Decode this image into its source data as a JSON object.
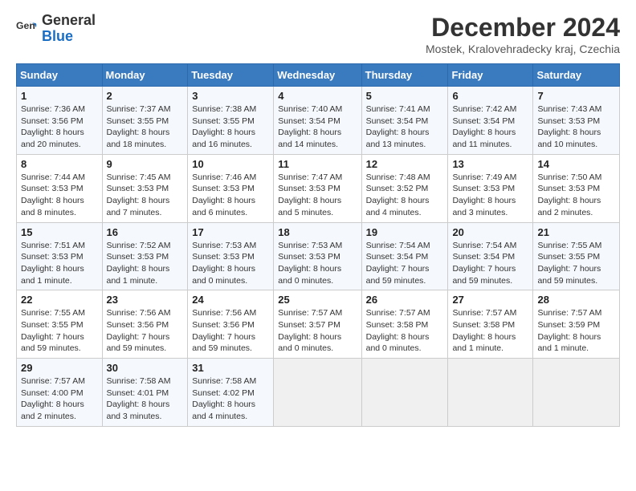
{
  "header": {
    "logo_general": "General",
    "logo_blue": "Blue",
    "title": "December 2024",
    "location": "Mostek, Kralovehradecky kraj, Czechia"
  },
  "weekdays": [
    "Sunday",
    "Monday",
    "Tuesday",
    "Wednesday",
    "Thursday",
    "Friday",
    "Saturday"
  ],
  "weeks": [
    [
      {
        "day": "1",
        "sunrise": "7:36 AM",
        "sunset": "3:56 PM",
        "daylight": "8 hours and 20 minutes."
      },
      {
        "day": "2",
        "sunrise": "7:37 AM",
        "sunset": "3:55 PM",
        "daylight": "8 hours and 18 minutes."
      },
      {
        "day": "3",
        "sunrise": "7:38 AM",
        "sunset": "3:55 PM",
        "daylight": "8 hours and 16 minutes."
      },
      {
        "day": "4",
        "sunrise": "7:40 AM",
        "sunset": "3:54 PM",
        "daylight": "8 hours and 14 minutes."
      },
      {
        "day": "5",
        "sunrise": "7:41 AM",
        "sunset": "3:54 PM",
        "daylight": "8 hours and 13 minutes."
      },
      {
        "day": "6",
        "sunrise": "7:42 AM",
        "sunset": "3:54 PM",
        "daylight": "8 hours and 11 minutes."
      },
      {
        "day": "7",
        "sunrise": "7:43 AM",
        "sunset": "3:53 PM",
        "daylight": "8 hours and 10 minutes."
      }
    ],
    [
      {
        "day": "8",
        "sunrise": "7:44 AM",
        "sunset": "3:53 PM",
        "daylight": "8 hours and 8 minutes."
      },
      {
        "day": "9",
        "sunrise": "7:45 AM",
        "sunset": "3:53 PM",
        "daylight": "8 hours and 7 minutes."
      },
      {
        "day": "10",
        "sunrise": "7:46 AM",
        "sunset": "3:53 PM",
        "daylight": "8 hours and 6 minutes."
      },
      {
        "day": "11",
        "sunrise": "7:47 AM",
        "sunset": "3:53 PM",
        "daylight": "8 hours and 5 minutes."
      },
      {
        "day": "12",
        "sunrise": "7:48 AM",
        "sunset": "3:52 PM",
        "daylight": "8 hours and 4 minutes."
      },
      {
        "day": "13",
        "sunrise": "7:49 AM",
        "sunset": "3:53 PM",
        "daylight": "8 hours and 3 minutes."
      },
      {
        "day": "14",
        "sunrise": "7:50 AM",
        "sunset": "3:53 PM",
        "daylight": "8 hours and 2 minutes."
      }
    ],
    [
      {
        "day": "15",
        "sunrise": "7:51 AM",
        "sunset": "3:53 PM",
        "daylight": "8 hours and 1 minute."
      },
      {
        "day": "16",
        "sunrise": "7:52 AM",
        "sunset": "3:53 PM",
        "daylight": "8 hours and 1 minute."
      },
      {
        "day": "17",
        "sunrise": "7:53 AM",
        "sunset": "3:53 PM",
        "daylight": "8 hours and 0 minutes."
      },
      {
        "day": "18",
        "sunrise": "7:53 AM",
        "sunset": "3:53 PM",
        "daylight": "8 hours and 0 minutes."
      },
      {
        "day": "19",
        "sunrise": "7:54 AM",
        "sunset": "3:54 PM",
        "daylight": "7 hours and 59 minutes."
      },
      {
        "day": "20",
        "sunrise": "7:54 AM",
        "sunset": "3:54 PM",
        "daylight": "7 hours and 59 minutes."
      },
      {
        "day": "21",
        "sunrise": "7:55 AM",
        "sunset": "3:55 PM",
        "daylight": "7 hours and 59 minutes."
      }
    ],
    [
      {
        "day": "22",
        "sunrise": "7:55 AM",
        "sunset": "3:55 PM",
        "daylight": "7 hours and 59 minutes."
      },
      {
        "day": "23",
        "sunrise": "7:56 AM",
        "sunset": "3:56 PM",
        "daylight": "7 hours and 59 minutes."
      },
      {
        "day": "24",
        "sunrise": "7:56 AM",
        "sunset": "3:56 PM",
        "daylight": "7 hours and 59 minutes."
      },
      {
        "day": "25",
        "sunrise": "7:57 AM",
        "sunset": "3:57 PM",
        "daylight": "8 hours and 0 minutes."
      },
      {
        "day": "26",
        "sunrise": "7:57 AM",
        "sunset": "3:58 PM",
        "daylight": "8 hours and 0 minutes."
      },
      {
        "day": "27",
        "sunrise": "7:57 AM",
        "sunset": "3:58 PM",
        "daylight": "8 hours and 1 minute."
      },
      {
        "day": "28",
        "sunrise": "7:57 AM",
        "sunset": "3:59 PM",
        "daylight": "8 hours and 1 minute."
      }
    ],
    [
      {
        "day": "29",
        "sunrise": "7:57 AM",
        "sunset": "4:00 PM",
        "daylight": "8 hours and 2 minutes."
      },
      {
        "day": "30",
        "sunrise": "7:58 AM",
        "sunset": "4:01 PM",
        "daylight": "8 hours and 3 minutes."
      },
      {
        "day": "31",
        "sunrise": "7:58 AM",
        "sunset": "4:02 PM",
        "daylight": "8 hours and 4 minutes."
      },
      null,
      null,
      null,
      null
    ]
  ]
}
